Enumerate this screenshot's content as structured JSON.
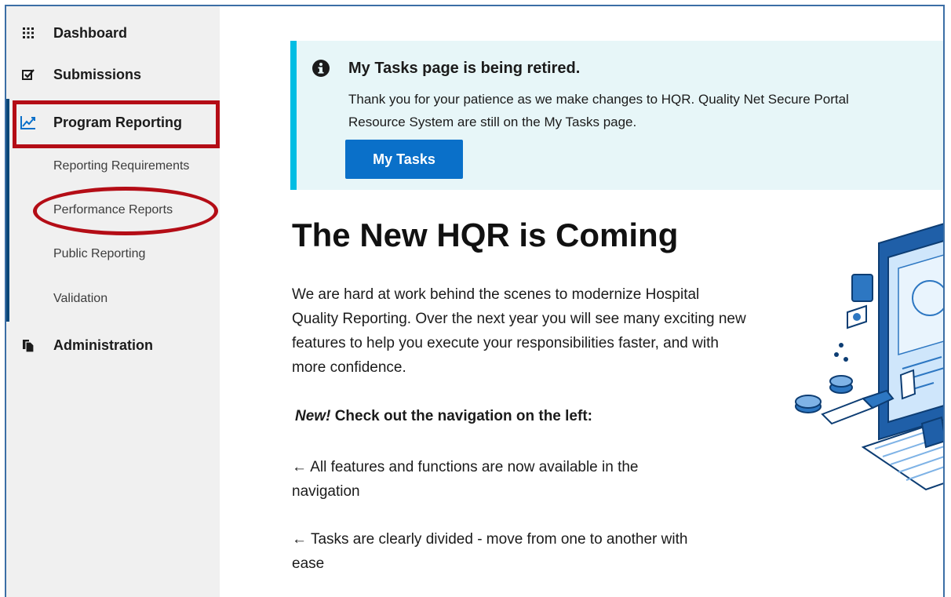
{
  "sidebar": {
    "items": [
      {
        "label": "Dashboard",
        "icon": "grid-icon"
      },
      {
        "label": "Submissions",
        "icon": "checkbox-icon"
      },
      {
        "label": "Program Reporting",
        "icon": "line-chart-icon"
      },
      {
        "label": "Administration",
        "icon": "documents-icon"
      }
    ],
    "subitems": [
      {
        "label": "Reporting Requirements"
      },
      {
        "label": "Performance Reports"
      },
      {
        "label": "Public Reporting"
      },
      {
        "label": "Validation"
      }
    ]
  },
  "alert": {
    "title": "My Tasks page is being retired.",
    "body": "Thank you for your patience as we make changes to HQR.  Quality Net Secure Portal\nResource System are still on the My Tasks page.",
    "button_label": "My Tasks",
    "icon": "info-icon"
  },
  "main": {
    "title": "The New HQR is Coming",
    "intro": "We are hard at work behind the scenes to modernize Hospital Quality Reporting. Over the next year you will see many exciting new features to help you execute your responsibilities faster, and with more confidence.",
    "nav_heading_new": "New!",
    "nav_heading_rest": "Check out the navigation on the left:",
    "features": [
      {
        "arrow": "←",
        "text": "All features and functions are now available in the navigation"
      },
      {
        "arrow": "←",
        "text": "Tasks are clearly divided  - move from one to another with ease"
      }
    ]
  },
  "colors": {
    "accent_blue": "#0a70c9",
    "alert_border": "#00bde3",
    "alert_bg": "#e7f6f8",
    "highlight_red": "#b40d16",
    "sidebar_bg": "#f0f0f0"
  }
}
